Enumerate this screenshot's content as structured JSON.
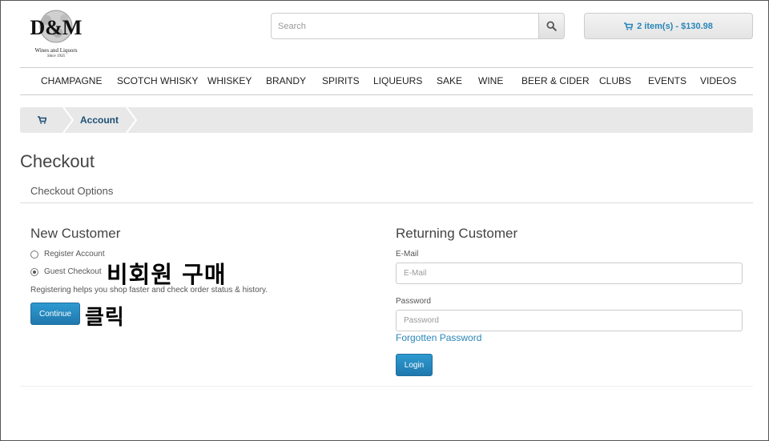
{
  "logo": {
    "mark": "D&M",
    "subtitle": "Wines and Liquors",
    "since": "Since 1935"
  },
  "search": {
    "placeholder": "Search",
    "icon": "search-icon"
  },
  "cart": {
    "label": "2 item(s) - $130.98",
    "icon": "shopping-cart-icon"
  },
  "menu": {
    "items": [
      {
        "label": "CHAMPAGNE"
      },
      {
        "label": "SCOTCH WHISKY"
      },
      {
        "label": "WHISKEY"
      },
      {
        "label": "BRANDY"
      },
      {
        "label": "SPIRITS"
      },
      {
        "label": "LIQUEURS"
      },
      {
        "label": "SAKE"
      },
      {
        "label": "WINE"
      },
      {
        "label": "BEER & CIDER"
      },
      {
        "label": "CLUBS"
      },
      {
        "label": "EVENTS"
      },
      {
        "label": "VIDEOS"
      }
    ]
  },
  "breadcrumb": {
    "home_icon": "shopping-cart-icon",
    "current": "Account"
  },
  "page": {
    "title": "Checkout",
    "panel_title": "Checkout Options"
  },
  "new_customer": {
    "heading": "New Customer",
    "options": [
      {
        "label": "Register Account",
        "selected": false
      },
      {
        "label": "Guest Checkout",
        "selected": true
      }
    ],
    "note": "Registering helps you shop faster and check order status & history.",
    "continue_label": "Continue"
  },
  "annotations": {
    "guest": "비회원 구매",
    "click": "클릭"
  },
  "returning_customer": {
    "heading": "Returning Customer",
    "email_label": "E-Mail",
    "email_placeholder": "E-Mail",
    "email_value": "",
    "password_label": "Password",
    "password_placeholder": "Password",
    "password_value": "",
    "forgot_label": "Forgotten Password",
    "login_label": "Login"
  },
  "colors": {
    "accent_blue": "#2a86b8",
    "button_blue": "#1f78ad",
    "breadcrumb_bg": "#e8e8e8",
    "breadcrumb_text": "#1e4f75"
  }
}
